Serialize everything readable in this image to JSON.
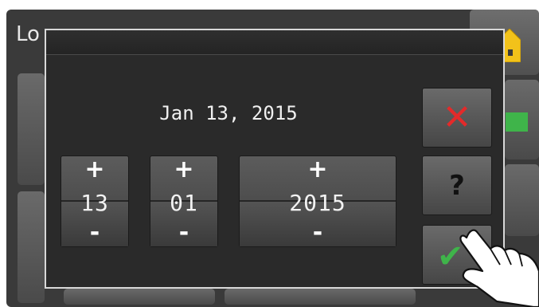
{
  "background": {
    "title": "Lo",
    "home_icon": "home-icon",
    "status_led_color": "#3fb44a"
  },
  "dialog": {
    "date_display": "Jan 13, 2015",
    "day": {
      "value": "13",
      "increment_label": "+",
      "decrement_label": "-"
    },
    "month": {
      "value": "01",
      "increment_label": "+",
      "decrement_label": "-"
    },
    "year": {
      "value": "2015",
      "increment_label": "+",
      "decrement_label": "-"
    },
    "buttons": {
      "cancel_icon": "close-icon",
      "help_label": "?",
      "confirm_icon": "checkmark-icon"
    }
  },
  "colors": {
    "cancel": "#e42a2a",
    "confirm": "#3fb44a",
    "dialog_bg": "#2a2a2a"
  }
}
